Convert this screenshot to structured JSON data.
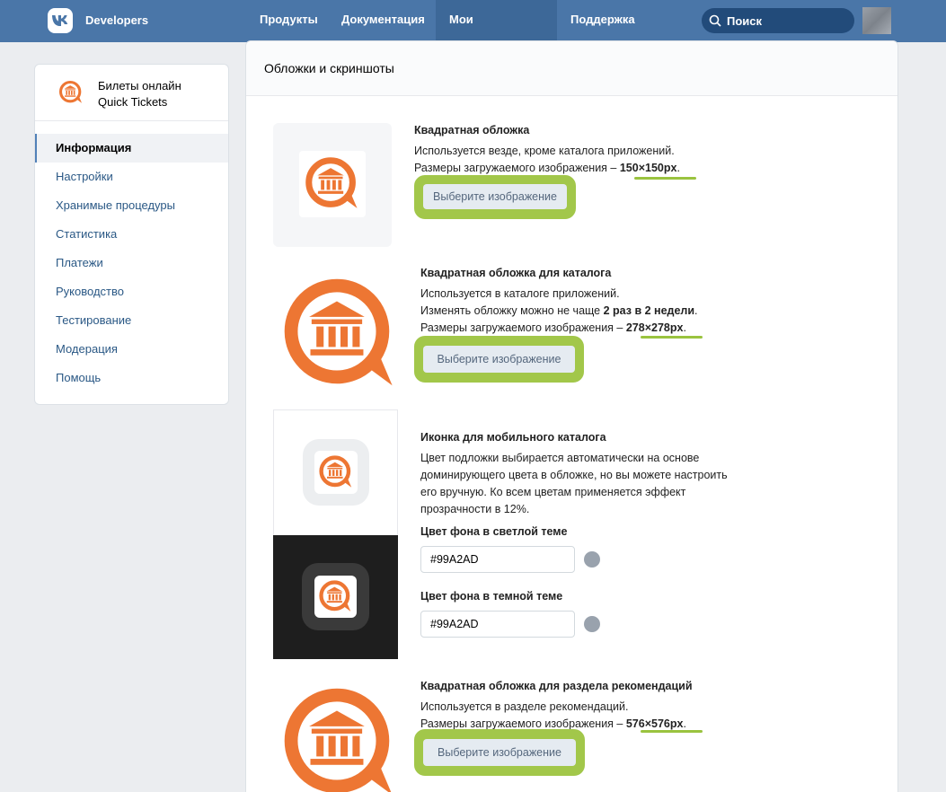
{
  "header": {
    "brand": "Developers",
    "nav": [
      "Продукты",
      "Документация",
      "Мои приложения",
      "Поддержка"
    ],
    "active_nav": "Мои приложения",
    "search_placeholder": "Поиск"
  },
  "sidebar": {
    "app_name": "Билеты онлайн",
    "app_subtitle": "Quick Tickets",
    "items": [
      {
        "label": "Информация",
        "active": true
      },
      {
        "label": "Настройки"
      },
      {
        "label": "Хранимые процедуры"
      },
      {
        "label": "Статистика"
      },
      {
        "label": "Платежи"
      },
      {
        "label": "Руководство"
      },
      {
        "label": "Тестирование"
      },
      {
        "label": "Модерация"
      },
      {
        "label": "Помощь"
      }
    ]
  },
  "main": {
    "title": "Обложки и скриншоты",
    "sections": {
      "square": {
        "title": "Квадратная обложка",
        "line1": "Используется везде, кроме каталога приложений.",
        "size_prefix": "Размеры загружаемого изображения – ",
        "size": "150×150px",
        "button": "Выберите изображение"
      },
      "catalog": {
        "title": "Квадратная обложка для каталога",
        "line1": "Используется в каталоге приложений.",
        "line2_prefix": "Изменять обложку можно не чаще ",
        "line2_bold": "2 раз в 2 недели",
        "size_prefix": "Размеры загружаемого изображения – ",
        "size": "278×278px",
        "button": "Выберите изображение"
      },
      "mobile": {
        "title": "Иконка для мобильного каталога",
        "text": [
          "Цвет подложки выбирается автоматически на основе",
          "доминирующего цвета в обложке, но вы можете настроить",
          "его вручную. Ко всем цветам применяется эффект",
          "прозрачности в 12%."
        ],
        "light_label": "Цвет фона в светлой теме",
        "light_value": "#99A2AD",
        "dark_label": "Цвет фона в темной теме",
        "dark_value": "#99A2AD"
      },
      "recommend": {
        "title": "Квадратная обложка для раздела рекомендаций",
        "line1": "Используется в разделе рекомендаций.",
        "size_prefix": "Размеры загружаемого изображения – ",
        "size": "576×576px",
        "button": "Выберите изображение"
      }
    }
  },
  "colors": {
    "header": "#4a76a8",
    "brand_orange": "#ed7633",
    "highlight_green": "#a2c74a",
    "link": "#2a5885"
  }
}
